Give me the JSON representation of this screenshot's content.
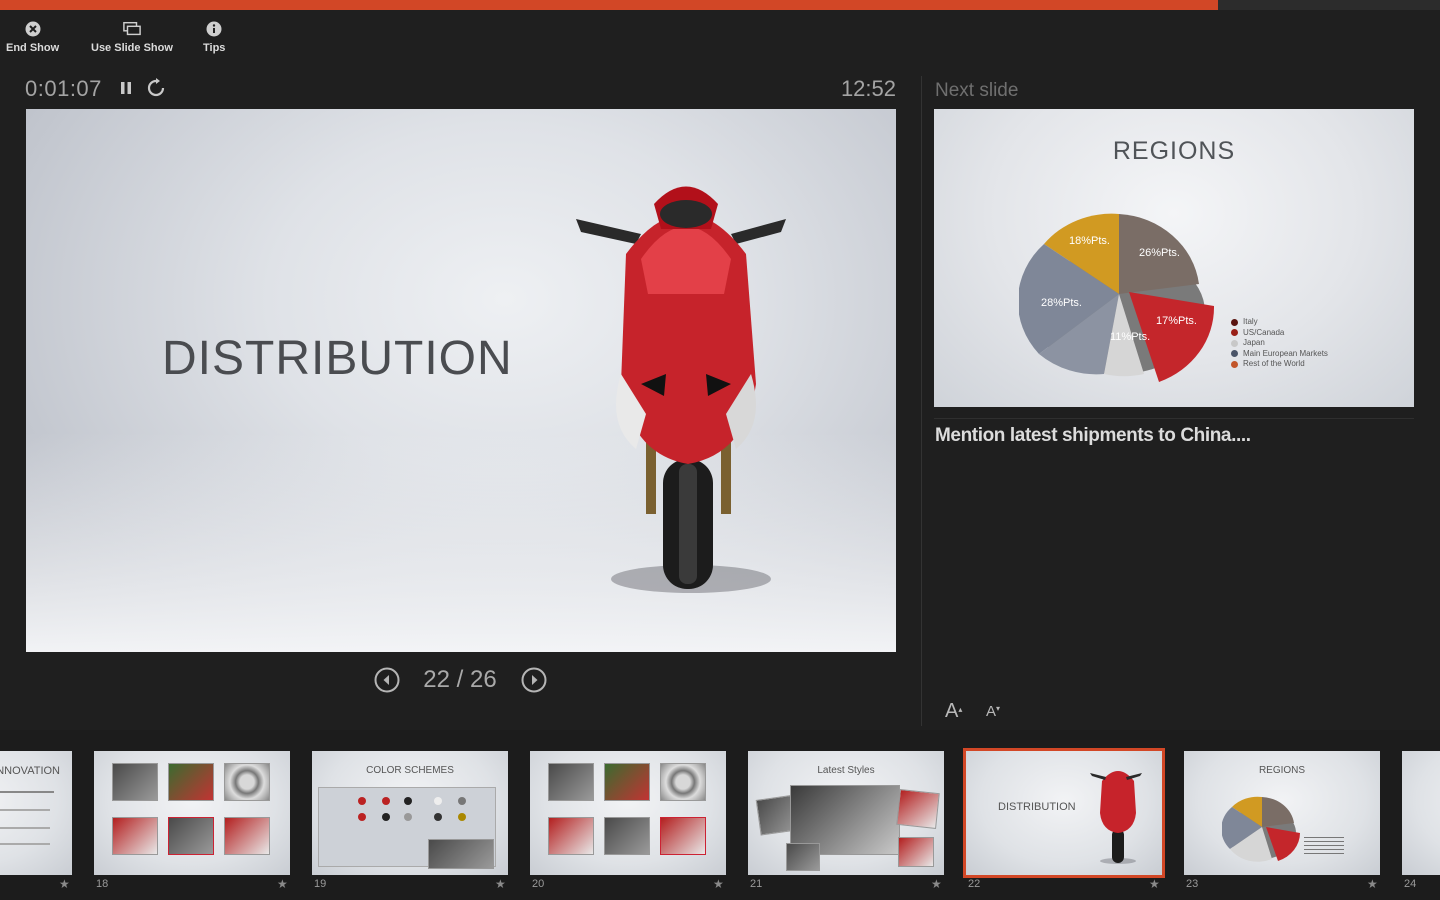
{
  "progress": {
    "fraction": 0.846
  },
  "toolbar": {
    "end_show": "End Show",
    "use_slide_show": "Use Slide Show",
    "tips": "Tips"
  },
  "presenter": {
    "elapsed": "0:01:07",
    "clock": "12:52",
    "counter": "22 / 26",
    "current_slide_title": "DISTRIBUTION",
    "next_label": "Next slide",
    "notes": "Mention latest shipments to China...."
  },
  "next_slide": {
    "title": "REGIONS",
    "pie_labels": [
      "18%Pts.",
      "26%Pts.",
      "28%Pts.",
      "11%Pts.",
      "17%Pts."
    ],
    "legend": [
      {
        "label": "Italy",
        "color": "#5a1410"
      },
      {
        "label": "US/Canada",
        "color": "#9a2018"
      },
      {
        "label": "Japan",
        "color": "#c8c8c8"
      },
      {
        "label": "Main European Markets",
        "color": "#4a5468"
      },
      {
        "label": "Rest of the World",
        "color": "#c2552a"
      }
    ]
  },
  "colors": {
    "accent": "#d24726",
    "background": "#1f1f1f"
  },
  "thumbnails": [
    {
      "num": "",
      "title": "NNOVATION",
      "kind": "text"
    },
    {
      "num": "18",
      "title": "",
      "kind": "grid"
    },
    {
      "num": "19",
      "title": "COLOR SCHEMES",
      "kind": "table"
    },
    {
      "num": "20",
      "title": "",
      "kind": "grid"
    },
    {
      "num": "21",
      "title": "Latest Styles",
      "kind": "photos"
    },
    {
      "num": "22",
      "title": "DISTRIBUTION",
      "kind": "bike"
    },
    {
      "num": "23",
      "title": "REGIONS",
      "kind": "pie"
    },
    {
      "num": "24",
      "title": "",
      "kind": "blank"
    }
  ]
}
